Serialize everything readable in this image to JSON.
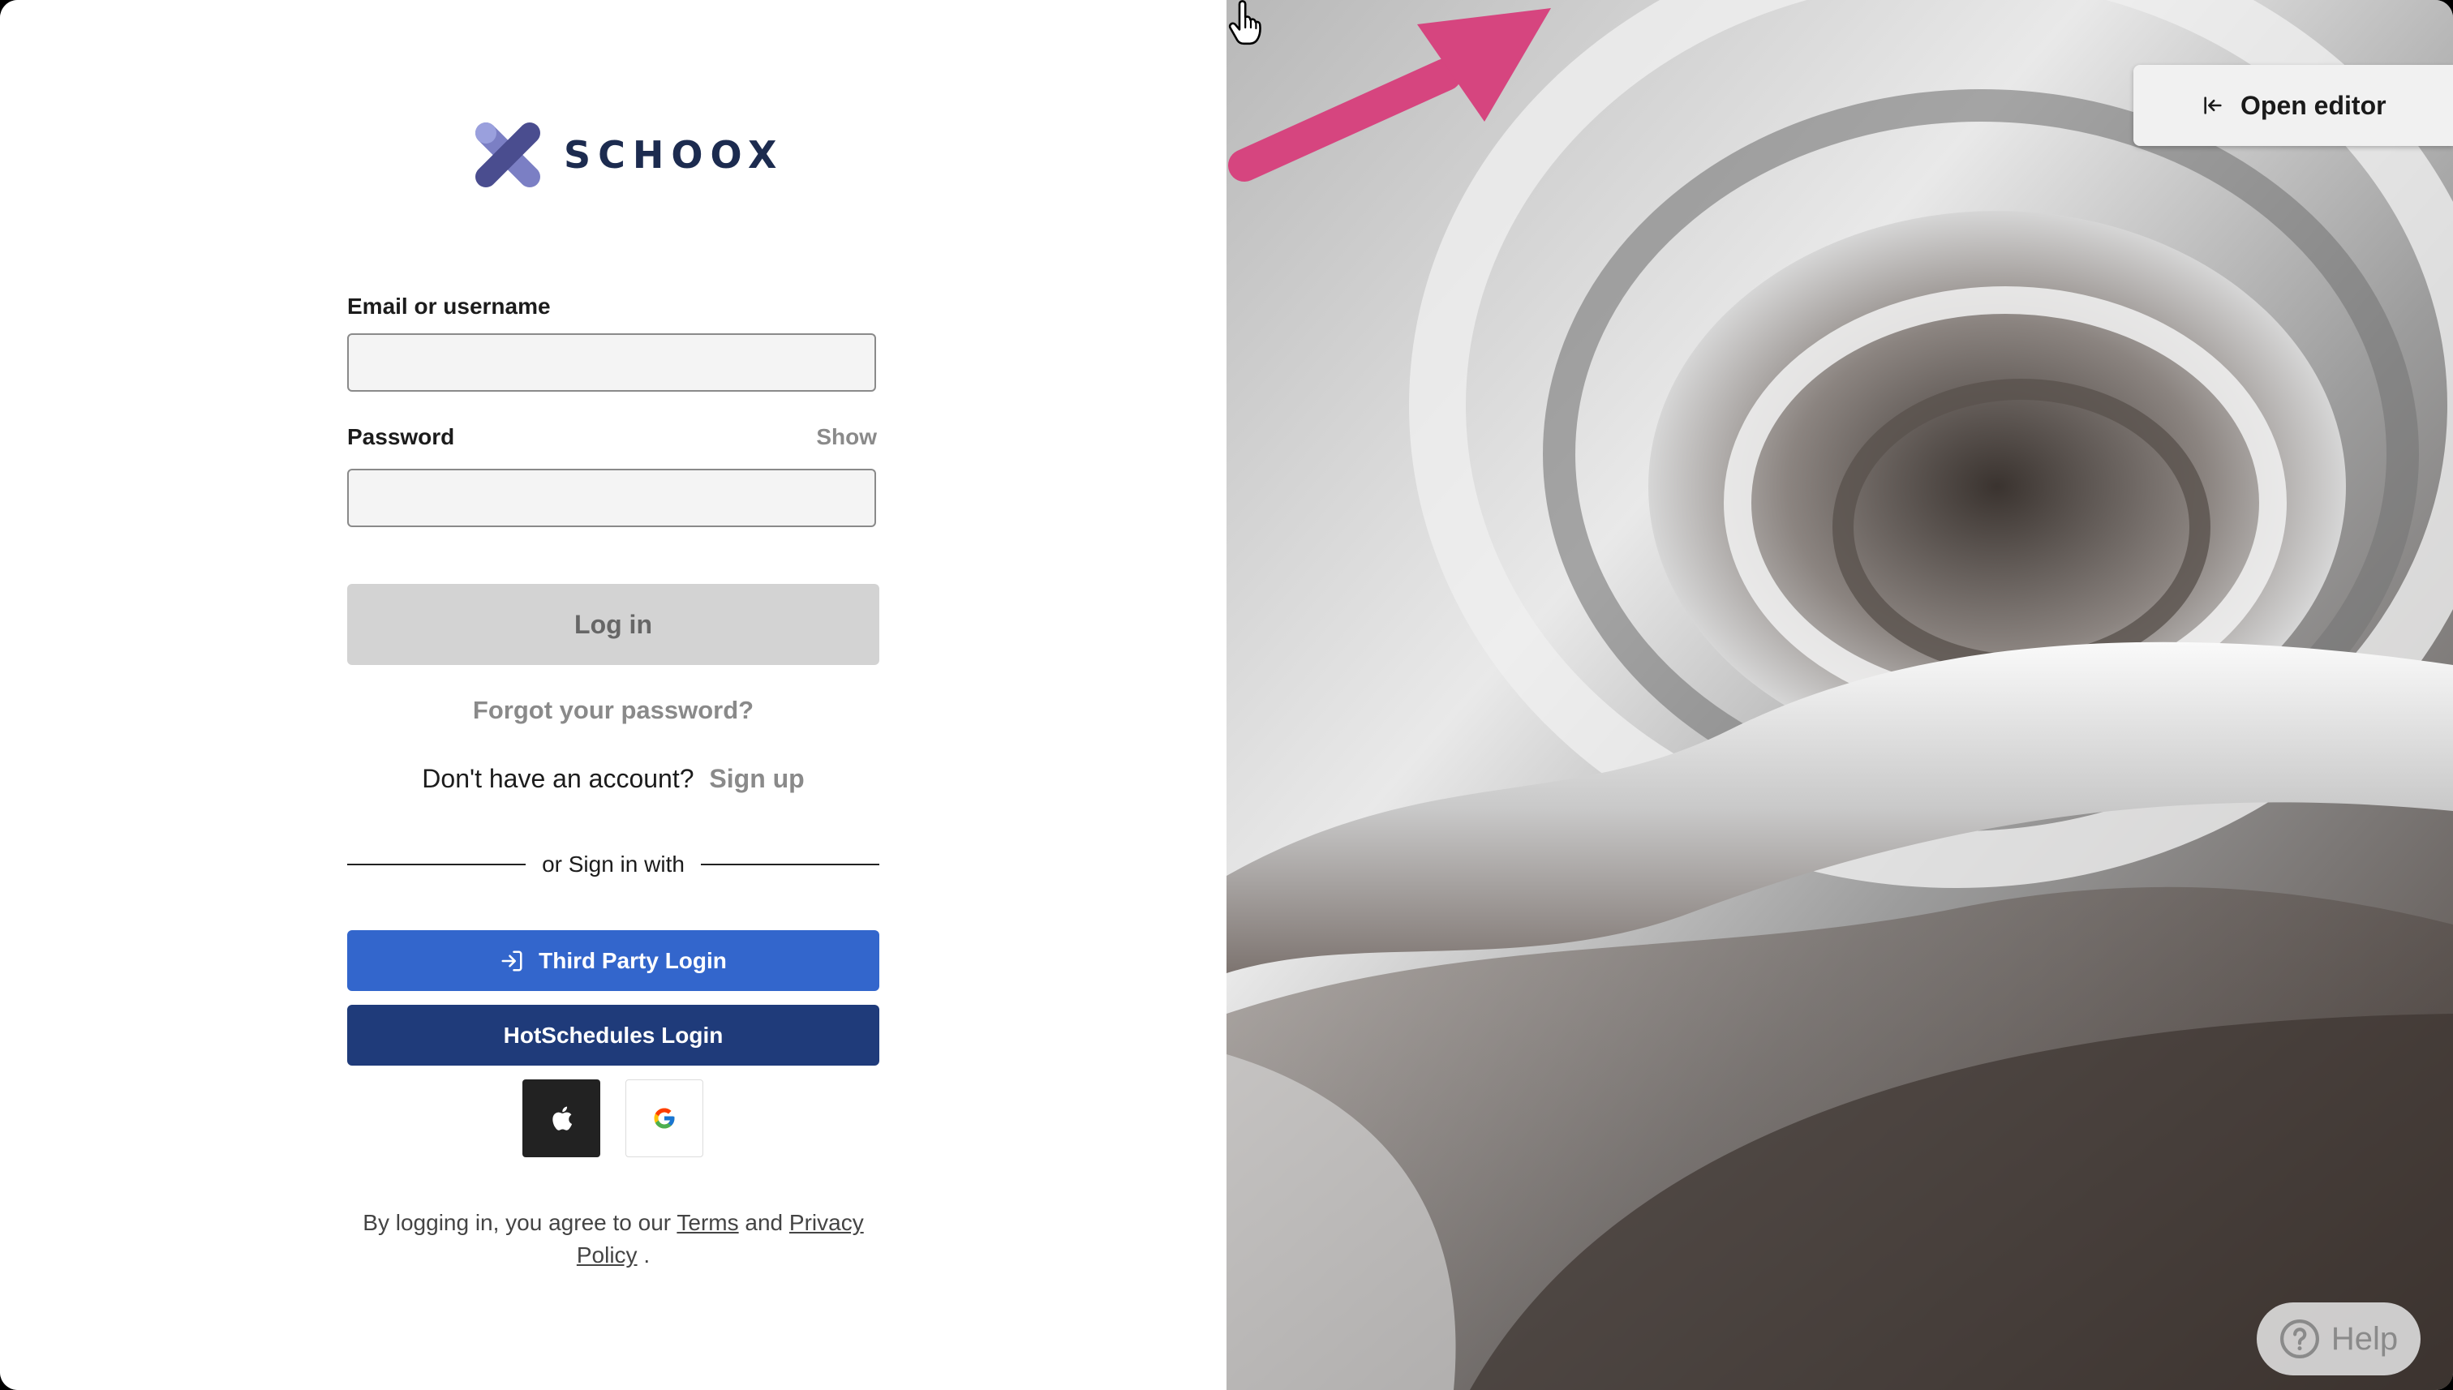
{
  "brand": {
    "name": "SCHOOX",
    "logo_icon": "schoox-x-logo"
  },
  "login_form": {
    "email_label": "Email or username",
    "email_value": "",
    "password_label": "Password",
    "password_value": "",
    "show_label": "Show",
    "login_button": "Log in",
    "forgot_password": "Forgot your password?",
    "no_account_text": "Don't have an account?",
    "signup_link": "Sign up",
    "divider_text": "or Sign in with",
    "third_party_button": "Third Party Login",
    "hotschedules_button": "HotSchedules Login",
    "social": [
      {
        "icon": "apple-icon"
      },
      {
        "icon": "google-icon"
      }
    ],
    "legal_prefix": "By logging in, you agree to our",
    "legal_terms": "Terms",
    "legal_and": "and",
    "legal_privacy": "Privacy Policy",
    "legal_suffix": "."
  },
  "overlay": {
    "open_editor_label": "Open editor",
    "help_label": "Help"
  },
  "colors": {
    "third_party_bg": "#3366cc",
    "hotschedules_bg": "#1f3b7a",
    "login_disabled_bg": "#d3d3d3",
    "annotation_arrow": "#d6457f",
    "brand_text": "#1c2b4f"
  }
}
